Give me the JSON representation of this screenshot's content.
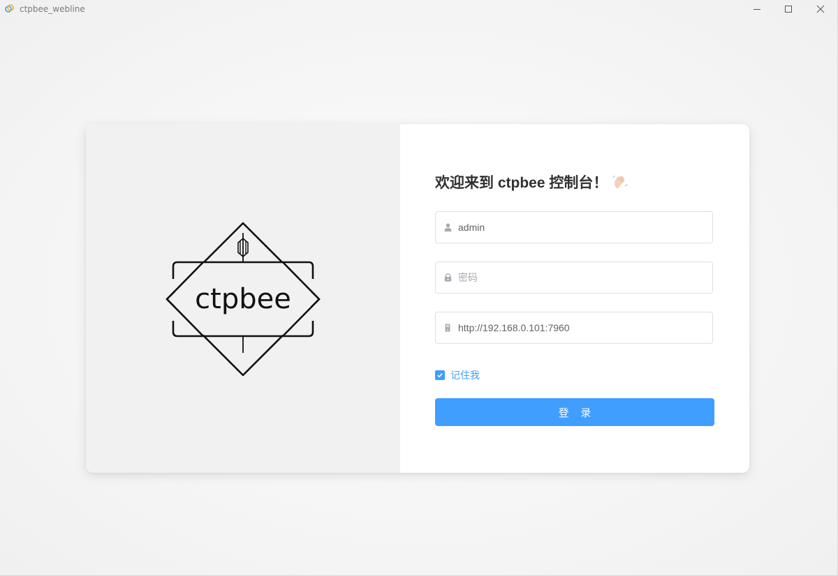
{
  "window": {
    "title": "ctpbee_webline"
  },
  "logo": {
    "text": "ctpbee"
  },
  "login": {
    "welcome": "欢迎来到 ctpbee 控制台！",
    "username_value": "admin",
    "password_placeholder": "密码",
    "password_value": "",
    "server_value": "http://192.168.0.101:7960",
    "remember_label": "记住我",
    "remember_checked": true,
    "submit_label": "登 录"
  },
  "colors": {
    "accent": "#409eff",
    "left_panel": "#f1f1f1",
    "title_text": "#303133"
  },
  "icons": {
    "user": "user-icon",
    "password": "lock-icon",
    "server": "server-icon",
    "wave": "waving-hand-icon"
  }
}
